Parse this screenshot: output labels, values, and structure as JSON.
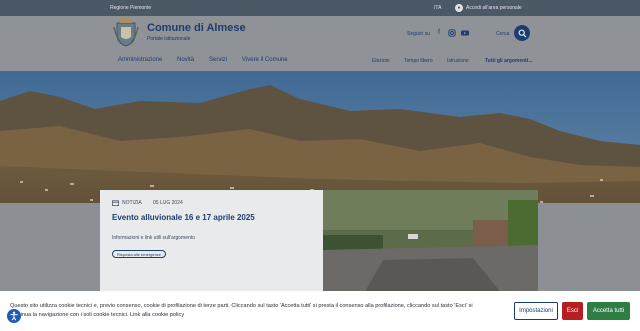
{
  "topbar": {
    "region": "Regione Piemonte",
    "lang": "ITA",
    "login": "Accedi all'area personale"
  },
  "header": {
    "title": "Comune di Almese",
    "subtitle": "Portale istituzionale",
    "social_label": "Seguici su",
    "search_label": "Cerca"
  },
  "nav": {
    "main": [
      "Amministrazione",
      "Novità",
      "Servizi",
      "Vivere il Comune"
    ],
    "secondary": [
      "Elezioni",
      "Tempo libero",
      "Istruzione",
      "Tutti gli argomenti..."
    ]
  },
  "card": {
    "category": "NOTIZIA",
    "date": "05 LUG 2024",
    "title": "Evento alluvionale 16 e 17 aprile 2025",
    "description": "Informazioni e link utili sull'argomento",
    "tag": "Risposta alle emergenze"
  },
  "cookie": {
    "text": "Questo sito utilizza cookie tecnici e, previo consenso, cookie di profilazione di terze parti. Cliccando sul tasto 'Accetta tutti' si presta il consenso alla profilazione, cliccando sul tasto 'Esci' si continua la navigazione con i soli cookie tecnici. Link alla cookie policy",
    "settings": "Impostazioni",
    "exit": "Esci",
    "accept": "Accetta tutti"
  },
  "colors": {
    "brand": "#1d3d70",
    "exit": "#b51f24",
    "accept": "#2e7d44"
  }
}
